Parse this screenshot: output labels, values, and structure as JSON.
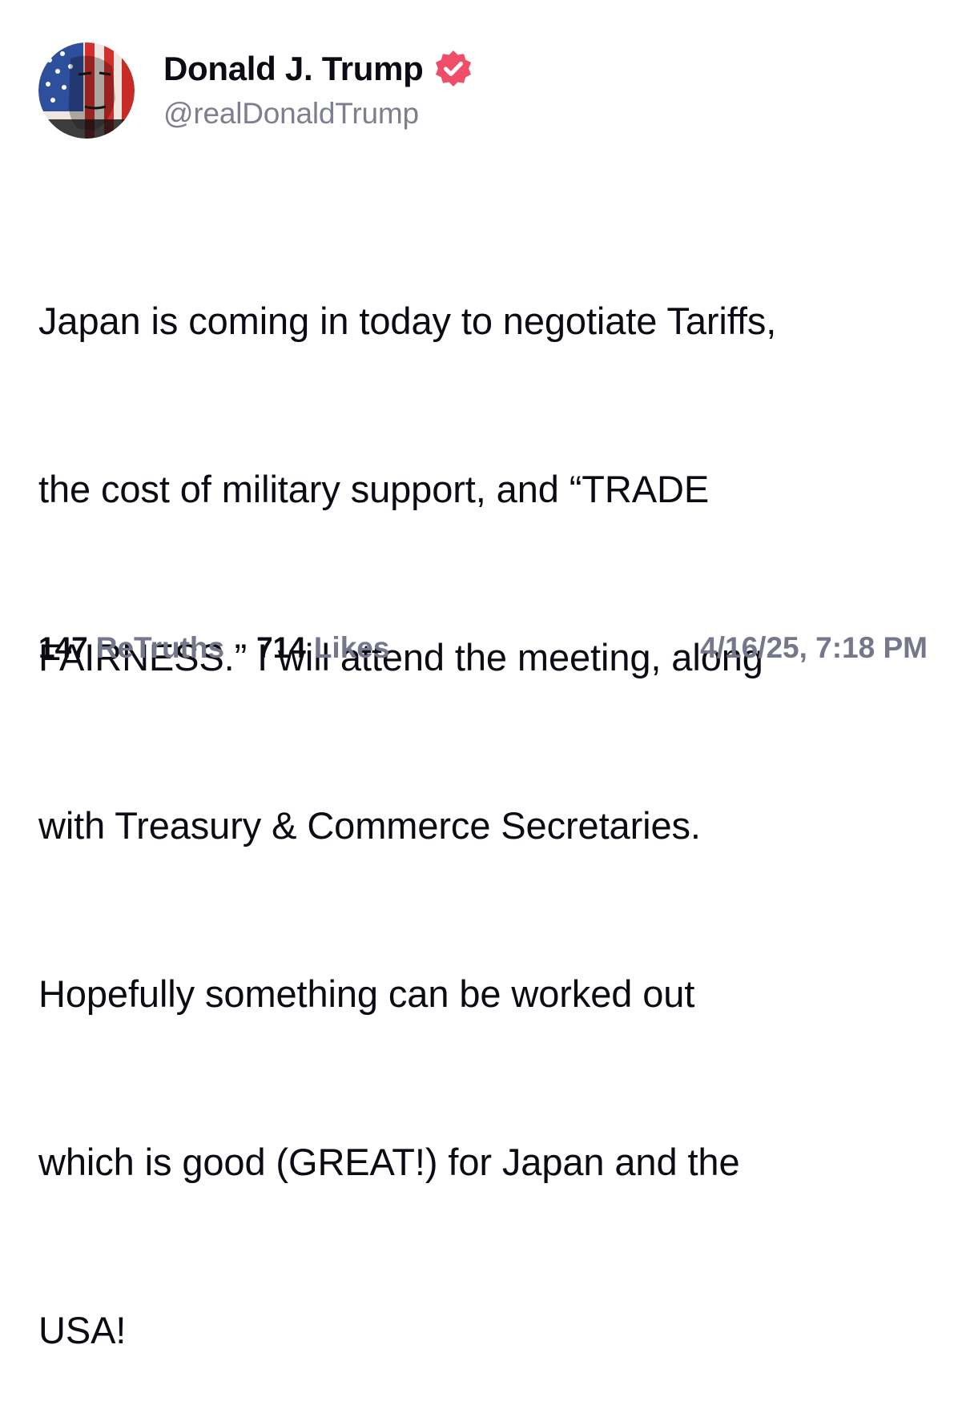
{
  "author": {
    "display_name": "Donald J. Trump",
    "handle": "@realDonaldTrump",
    "verified": true,
    "verified_color": "#ee4e68",
    "avatar_icon": "flag-face-avatar"
  },
  "post": {
    "lines": [
      "Japan is coming in today to negotiate Tariffs,",
      "the cost of military support, and “TRADE",
      "FAIRNESS.” I will attend the meeting, along",
      "with Treasury & Commerce Secretaries.",
      "Hopefully something can be worked out",
      "which is good (GREAT!) for Japan and the",
      "USA!"
    ]
  },
  "stats": {
    "retruths_count": "147",
    "retruths_label": "ReTruths",
    "likes_count": "714",
    "likes_label": "Likes"
  },
  "timestamp": "4/16/25, 7:18 PM",
  "colors": {
    "text": "#0b0b14",
    "muted": "#75778a",
    "background": "#ffffff"
  }
}
